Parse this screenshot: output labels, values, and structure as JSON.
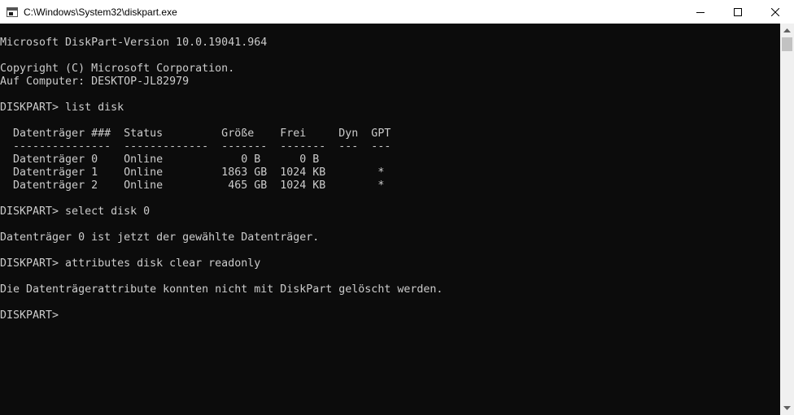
{
  "window": {
    "title": "C:\\Windows\\System32\\diskpart.exe"
  },
  "console": {
    "lines": [
      "Microsoft DiskPart-Version 10.0.19041.964",
      "",
      "Copyright (C) Microsoft Corporation.",
      "Auf Computer: DESKTOP-JL82979",
      "",
      "DISKPART> list disk",
      "",
      "  Datenträger ###  Status         Größe    Frei     Dyn  GPT",
      "  ---------------  -------------  -------  -------  ---  ---",
      "  Datenträger 0    Online            0 B      0 B",
      "  Datenträger 1    Online         1863 GB  1024 KB        *",
      "  Datenträger 2    Online          465 GB  1024 KB        *",
      "",
      "DISKPART> select disk 0",
      "",
      "Datenträger 0 ist jetzt der gewählte Datenträger.",
      "",
      "DISKPART> attributes disk clear readonly",
      "",
      "Die Datenträgerattribute konnten nicht mit DiskPart gelöscht werden.",
      "",
      "DISKPART> "
    ]
  },
  "icons": {
    "app": "console-app-icon",
    "minimize": "minimize-icon",
    "maximize": "maximize-icon",
    "close": "close-icon",
    "scroll_up": "scroll-up-arrow-icon",
    "scroll_down": "scroll-down-arrow-icon"
  },
  "colors": {
    "console_background": "#0c0c0c",
    "console_text": "#cccccc",
    "titlebar_background": "#ffffff"
  }
}
